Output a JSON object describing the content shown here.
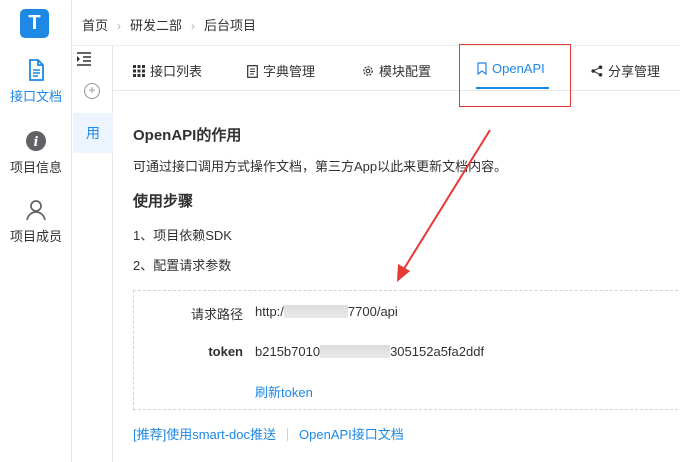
{
  "rail": {
    "logo_letter": "T",
    "items": [
      {
        "label": "接口文档",
        "icon": "document-icon"
      },
      {
        "label": "项目信息",
        "icon": "info-icon"
      },
      {
        "label": "项目成员",
        "icon": "person-icon"
      }
    ]
  },
  "sub_sidebar": {
    "active_label": "用"
  },
  "breadcrumb": [
    "首页",
    "研发二部",
    "后台项目"
  ],
  "tabs": [
    {
      "label": "接口列表",
      "icon": "grid-icon"
    },
    {
      "label": "字典管理",
      "icon": "doc-icon"
    },
    {
      "label": "模块配置",
      "icon": "gear-icon"
    },
    {
      "label": "OpenAPI",
      "icon": "bookmark-icon"
    },
    {
      "label": "分享管理",
      "icon": "share-icon"
    }
  ],
  "content": {
    "title": "OpenAPI的作用",
    "description": "可通过接口调用方式操作文档，第三方App以此来更新文档内容。",
    "steps_title": "使用步骤",
    "steps": [
      "1、项目依赖SDK",
      "2、配置请求参数"
    ],
    "request_path_label": "请求路径",
    "request_path_prefix": "http:/",
    "request_path_suffix": "7700/api",
    "token_label": "token",
    "token_prefix": "b215b7010",
    "token_suffix": "305152a5fa2ddf",
    "refresh_label": "刷新token"
  },
  "footer": {
    "link1": "[推荐]使用smart-doc推送",
    "link2": "OpenAPI接口文档"
  },
  "colors": {
    "accent": "#1e88e5",
    "annotation": "#e53935"
  }
}
